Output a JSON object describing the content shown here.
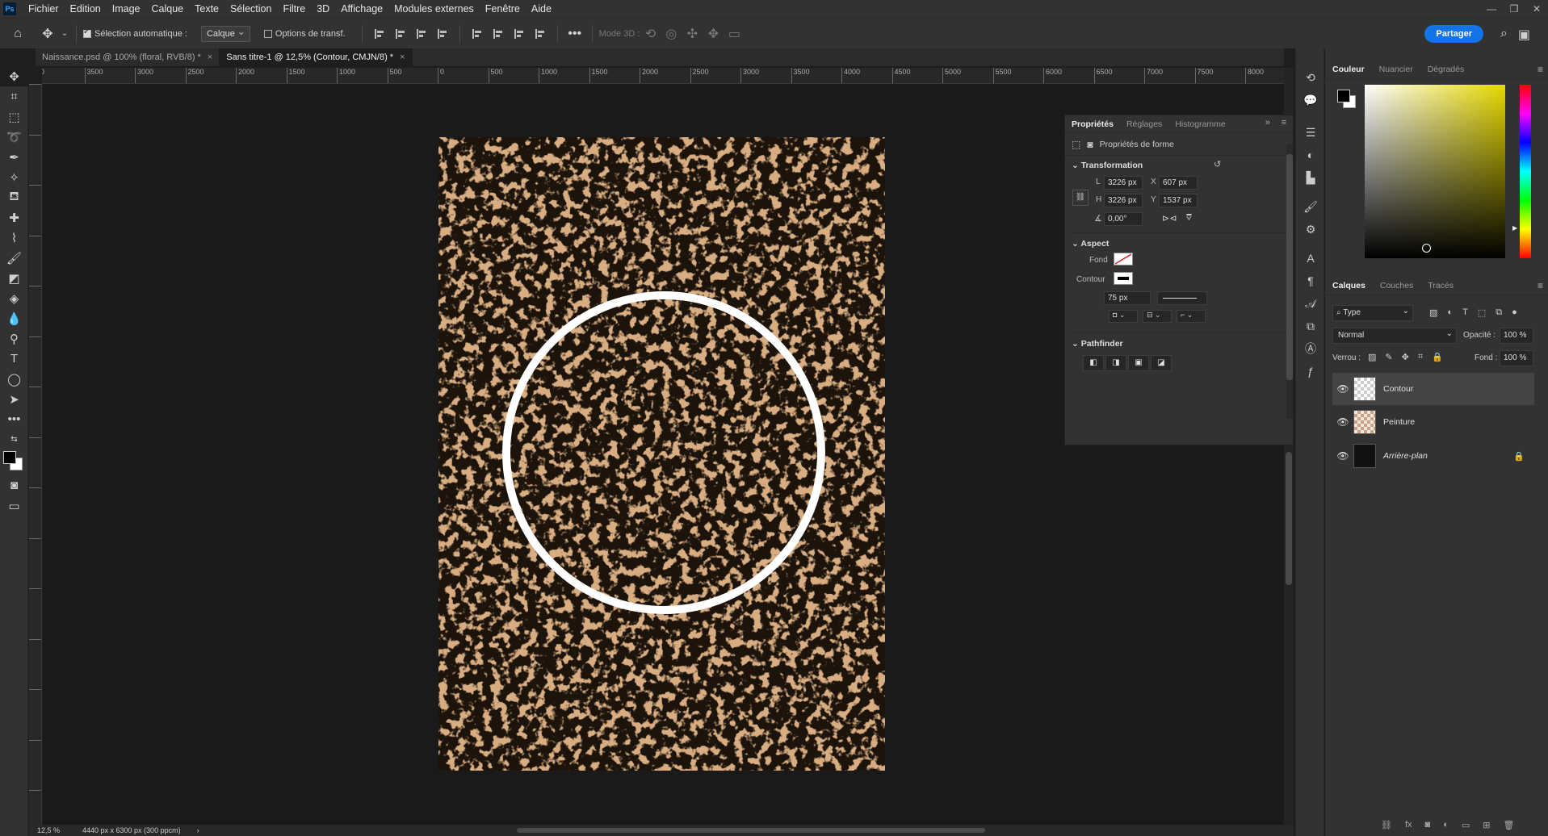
{
  "app": {
    "logo": "Ps"
  },
  "menu": [
    "Fichier",
    "Edition",
    "Image",
    "Calque",
    "Texte",
    "Sélection",
    "Filtre",
    "3D",
    "Affichage",
    "Modules externes",
    "Fenêtre",
    "Aide"
  ],
  "options": {
    "auto_select_label": "Sélection automatique :",
    "auto_select_value": "Calque",
    "transform_label": "Options de transf.",
    "mode3d_label": "Mode 3D :",
    "share_label": "Partager"
  },
  "tabs": [
    {
      "label": "Naissance.psd @ 100% (floral, RVB/8) *"
    },
    {
      "label": "Sans titre-1 @ 12,5% (Contour, CMJN/8) *"
    }
  ],
  "ruler_h": [
    "00",
    "3500",
    "3000",
    "2500",
    "2000",
    "1500",
    "1000",
    "500",
    "0",
    "500",
    "1000",
    "1500",
    "2000",
    "2500",
    "3000",
    "3500",
    "4000",
    "4500",
    "5000",
    "5500",
    "6000",
    "6500",
    "7000",
    "7500",
    "8000"
  ],
  "status": {
    "zoom": "12,5 %",
    "doc_size": "4440 px x 6300 px (300 ppcm)"
  },
  "properties": {
    "tabs": [
      "Propriétés",
      "Réglages",
      "Histogramme"
    ],
    "title": "Propriétés de forme",
    "transformation": {
      "label": "Transformation",
      "W_label": "L",
      "W": "3226 px",
      "H_label": "H",
      "H": "3226 px",
      "X_label": "X",
      "X": "607 px",
      "Y_label": "Y",
      "Y": "1537 px",
      "angle": "0,00°"
    },
    "aspect": {
      "label": "Aspect",
      "fill_label": "Fond",
      "stroke_label": "Contour",
      "stroke_width": "75 px"
    },
    "pathfinder": {
      "label": "Pathfinder"
    }
  },
  "color_panel": {
    "tabs": [
      "Couleur",
      "Nuancier",
      "Dégradés"
    ]
  },
  "layers_panel": {
    "tabs": [
      "Calques",
      "Couches",
      "Tracés"
    ],
    "filter": "Type",
    "blend_mode": "Normal",
    "opacity_label": "Opacité :",
    "opacity": "100 %",
    "lock_label": "Verrou :",
    "fill_label": "Fond :",
    "fill": "100 %",
    "layers": [
      {
        "name": "Contour",
        "selected": true
      },
      {
        "name": "Peinture",
        "selected": false
      },
      {
        "name": "Arrière-plan",
        "selected": false,
        "locked": true
      }
    ]
  }
}
